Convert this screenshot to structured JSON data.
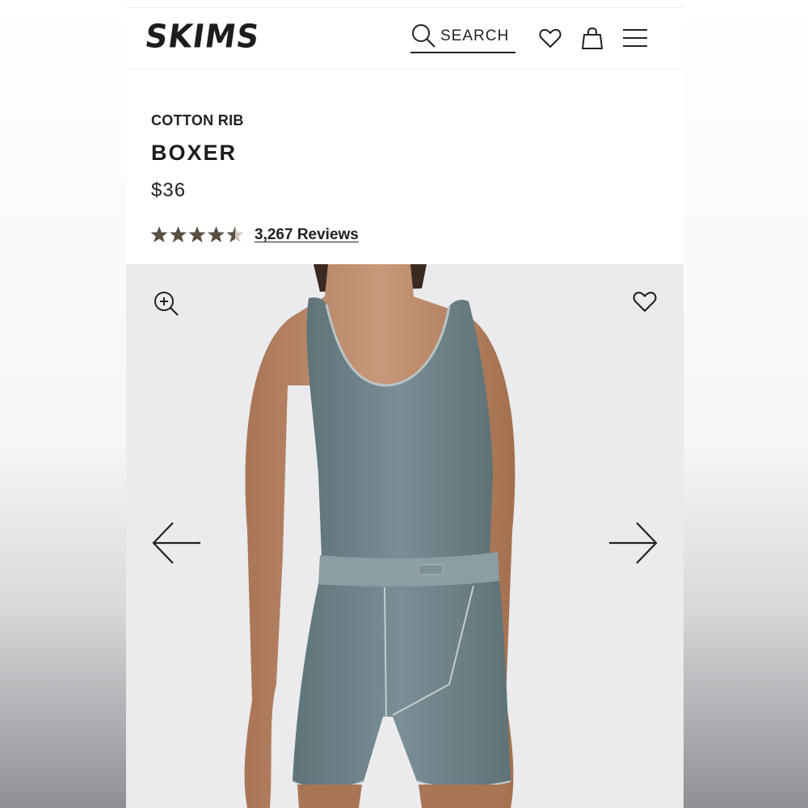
{
  "header": {
    "logo": "SKIMS",
    "search_label": "SEARCH",
    "icons": [
      "search-icon",
      "heart-icon",
      "bag-icon",
      "menu-icon"
    ]
  },
  "product": {
    "collection": "COTTON RIB",
    "title": "BOXER",
    "price": "$36",
    "rating": 4.5,
    "rating_max": 5,
    "reviews_label": "3,267 Reviews"
  },
  "gallery": {
    "icons": [
      "zoom-in-icon",
      "heart-icon",
      "arrow-left-icon",
      "arrow-right-icon"
    ]
  },
  "colors": {
    "text": "#222222",
    "star": "#5a4f43",
    "product_color": "#6f848a",
    "gallery_bg": "#ebebed"
  }
}
